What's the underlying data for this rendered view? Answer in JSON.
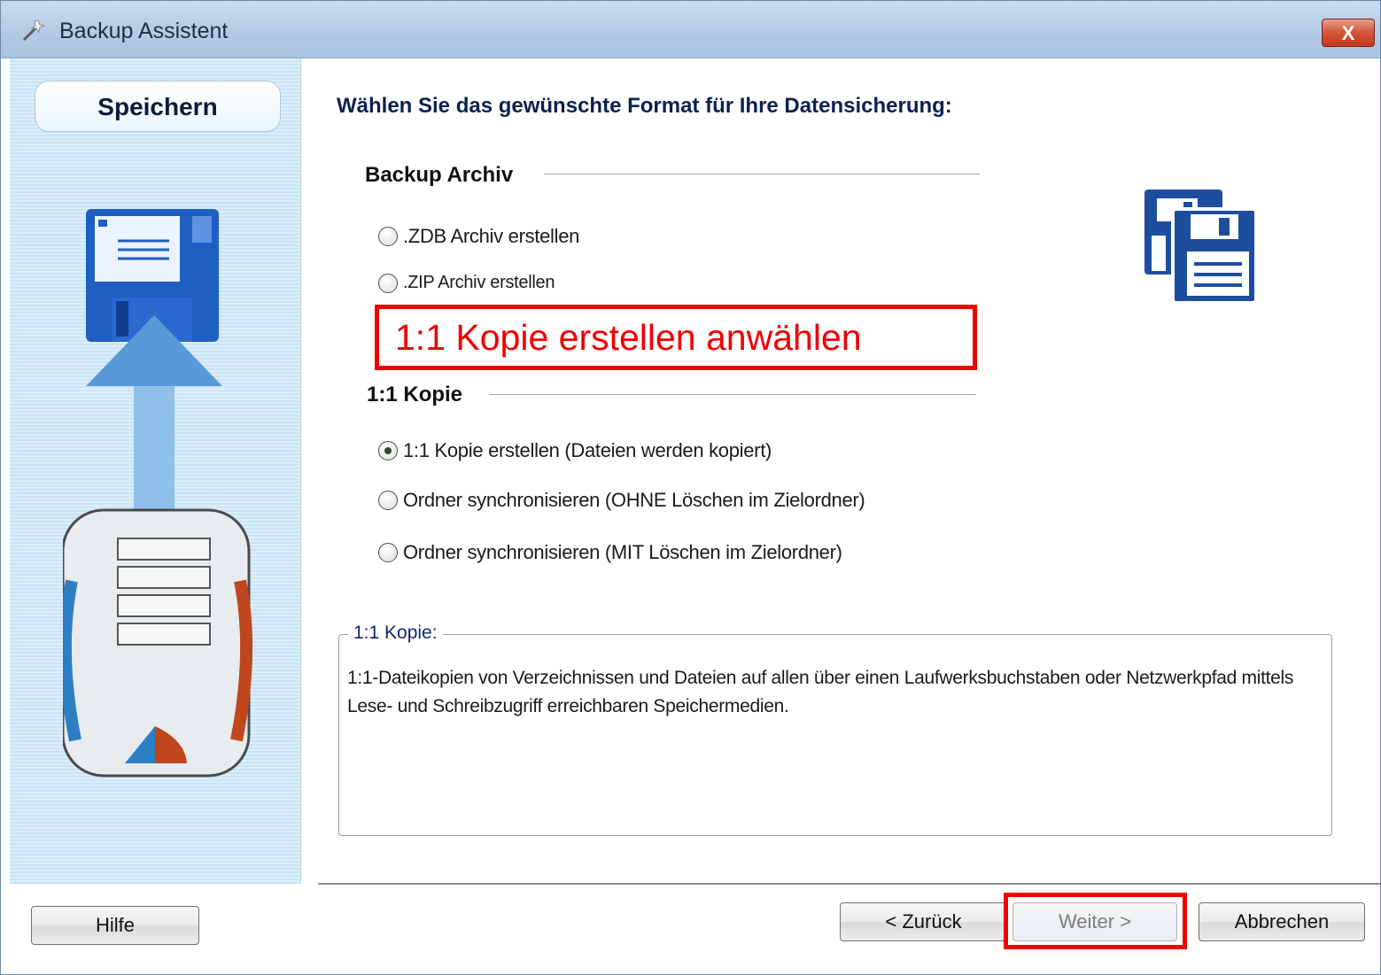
{
  "window": {
    "title": "Backup Assistent",
    "close_label": "X"
  },
  "sidebar": {
    "tab_label": "Speichern"
  },
  "main": {
    "heading": "Wählen Sie das gewünschte Format für Ihre Datensicherung:",
    "group_archive": {
      "title": "Backup Archiv",
      "options": [
        {
          "label": ".ZDB Archiv erstellen",
          "checked": false
        },
        {
          "label": ".ZIP Archiv erstellen",
          "checked": false
        }
      ]
    },
    "callout": "1:1 Kopie erstellen anwählen",
    "group_copy": {
      "title": "1:1 Kopie",
      "options": [
        {
          "label": "1:1 Kopie erstellen (Dateien werden kopiert)",
          "checked": true
        },
        {
          "label": "Ordner synchronisieren (OHNE Löschen im Zielordner)",
          "checked": false
        },
        {
          "label": "Ordner synchronisieren (MIT Löschen im Zielordner)",
          "checked": false
        }
      ]
    },
    "description": {
      "legend": "1:1 Kopie:",
      "text": "1:1-Dateikopien von Verzeichnissen und Dateien auf allen über einen Laufwerksbuchstaben oder Netzwerkpfad mittels Lese- und Schreibzugriff erreichbaren Speichermedien."
    }
  },
  "footer": {
    "help": "Hilfe",
    "back": "< Zurück",
    "next": "Weiter >",
    "cancel": "Abbrechen"
  },
  "colors": {
    "highlight": "#ee0000",
    "heading": "#0b2150"
  },
  "icons": [
    "wand-icon",
    "close-icon",
    "floppy-disk-icon",
    "upload-arrow-icon",
    "backup-device-icon",
    "floppy-stack-icon"
  ]
}
